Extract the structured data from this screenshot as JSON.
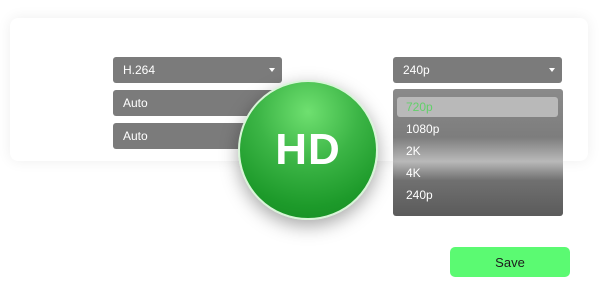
{
  "settings": {
    "codec_value": "H.264",
    "field_2_value": "Auto",
    "field_3_value": "Auto",
    "resolution_value": "240p"
  },
  "resolution_menu": {
    "options": [
      "720p",
      "1080p",
      "2K",
      "4K",
      "240p"
    ],
    "highlighted": "720p"
  },
  "badge": {
    "text": "HD",
    "color": "#1d9a2a"
  },
  "actions": {
    "save_label": "Save"
  },
  "colors": {
    "select_bg": "#7b7b7b",
    "accent_green": "#5bfa72",
    "highlight_text": "#62d06a"
  }
}
